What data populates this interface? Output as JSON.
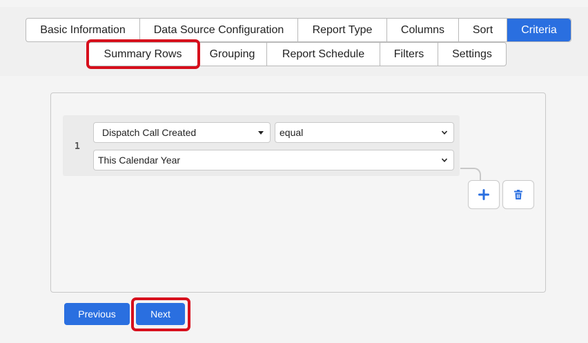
{
  "tabs_row1": [
    {
      "label": "Basic Information"
    },
    {
      "label": "Data Source Configuration"
    },
    {
      "label": "Report Type"
    },
    {
      "label": "Columns"
    },
    {
      "label": "Sort"
    },
    {
      "label": "Criteria"
    }
  ],
  "tabs_row2": [
    {
      "label": "Summary Rows"
    },
    {
      "label": "Grouping"
    },
    {
      "label": "Report Schedule"
    },
    {
      "label": "Filters"
    },
    {
      "label": "Settings"
    }
  ],
  "active_tab": "Criteria",
  "rule": {
    "number": "1",
    "field": "Dispatch Call Created",
    "operator": "equal",
    "value": "This Calendar Year"
  },
  "buttons": {
    "previous": "Previous",
    "next": "Next"
  },
  "colors": {
    "accent": "#2a6fe0",
    "highlight": "#d70f1c"
  },
  "icons": {
    "add": "plus-icon",
    "delete": "trash-icon",
    "dropdown": "chevron-down-icon"
  }
}
